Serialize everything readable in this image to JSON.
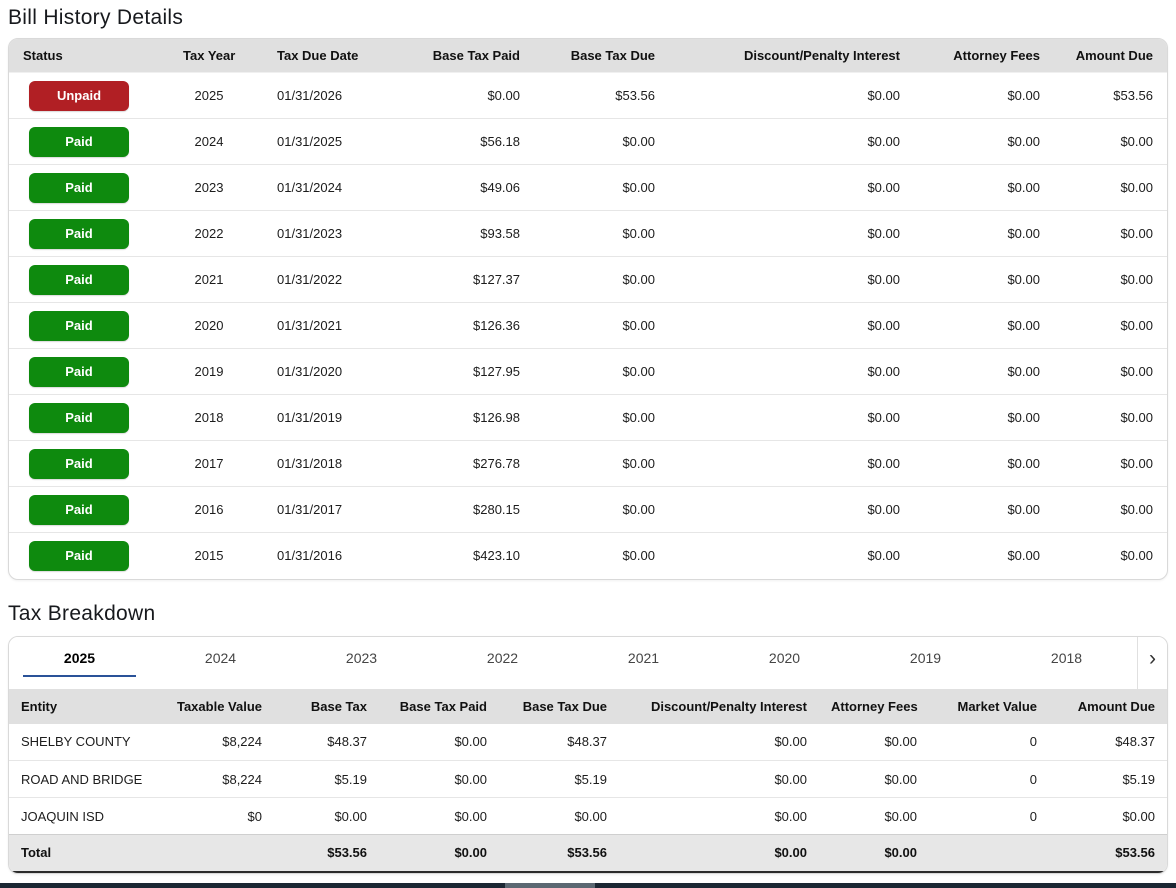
{
  "page": {
    "bill_history_title": "Bill History Details",
    "tax_breakdown_title": "Tax Breakdown"
  },
  "icons": {
    "next_tab": "›"
  },
  "colors": {
    "unpaid_badge": "#b11f24",
    "paid_badge": "#0e8a0e",
    "active_tab_underline": "#2a5298",
    "header_bg": "#e0e0e0"
  },
  "bill_history": {
    "columns": [
      "Status",
      "Tax Year",
      "Tax Due Date",
      "Base Tax Paid",
      "Base Tax Due",
      "Discount/Penalty Interest",
      "Attorney Fees",
      "Amount Due"
    ],
    "rows": [
      {
        "status": "Unpaid",
        "status_type": "unpaid",
        "tax_year": "2025",
        "tax_due_date": "01/31/2026",
        "base_tax_paid": "$0.00",
        "base_tax_due": "$53.56",
        "discount_penalty_interest": "$0.00",
        "attorney_fees": "$0.00",
        "amount_due": "$53.56"
      },
      {
        "status": "Paid",
        "status_type": "paid",
        "tax_year": "2024",
        "tax_due_date": "01/31/2025",
        "base_tax_paid": "$56.18",
        "base_tax_due": "$0.00",
        "discount_penalty_interest": "$0.00",
        "attorney_fees": "$0.00",
        "amount_due": "$0.00"
      },
      {
        "status": "Paid",
        "status_type": "paid",
        "tax_year": "2023",
        "tax_due_date": "01/31/2024",
        "base_tax_paid": "$49.06",
        "base_tax_due": "$0.00",
        "discount_penalty_interest": "$0.00",
        "attorney_fees": "$0.00",
        "amount_due": "$0.00"
      },
      {
        "status": "Paid",
        "status_type": "paid",
        "tax_year": "2022",
        "tax_due_date": "01/31/2023",
        "base_tax_paid": "$93.58",
        "base_tax_due": "$0.00",
        "discount_penalty_interest": "$0.00",
        "attorney_fees": "$0.00",
        "amount_due": "$0.00"
      },
      {
        "status": "Paid",
        "status_type": "paid",
        "tax_year": "2021",
        "tax_due_date": "01/31/2022",
        "base_tax_paid": "$127.37",
        "base_tax_due": "$0.00",
        "discount_penalty_interest": "$0.00",
        "attorney_fees": "$0.00",
        "amount_due": "$0.00"
      },
      {
        "status": "Paid",
        "status_type": "paid",
        "tax_year": "2020",
        "tax_due_date": "01/31/2021",
        "base_tax_paid": "$126.36",
        "base_tax_due": "$0.00",
        "discount_penalty_interest": "$0.00",
        "attorney_fees": "$0.00",
        "amount_due": "$0.00"
      },
      {
        "status": "Paid",
        "status_type": "paid",
        "tax_year": "2019",
        "tax_due_date": "01/31/2020",
        "base_tax_paid": "$127.95",
        "base_tax_due": "$0.00",
        "discount_penalty_interest": "$0.00",
        "attorney_fees": "$0.00",
        "amount_due": "$0.00"
      },
      {
        "status": "Paid",
        "status_type": "paid",
        "tax_year": "2018",
        "tax_due_date": "01/31/2019",
        "base_tax_paid": "$126.98",
        "base_tax_due": "$0.00",
        "discount_penalty_interest": "$0.00",
        "attorney_fees": "$0.00",
        "amount_due": "$0.00"
      },
      {
        "status": "Paid",
        "status_type": "paid",
        "tax_year": "2017",
        "tax_due_date": "01/31/2018",
        "base_tax_paid": "$276.78",
        "base_tax_due": "$0.00",
        "discount_penalty_interest": "$0.00",
        "attorney_fees": "$0.00",
        "amount_due": "$0.00"
      },
      {
        "status": "Paid",
        "status_type": "paid",
        "tax_year": "2016",
        "tax_due_date": "01/31/2017",
        "base_tax_paid": "$280.15",
        "base_tax_due": "$0.00",
        "discount_penalty_interest": "$0.00",
        "attorney_fees": "$0.00",
        "amount_due": "$0.00"
      },
      {
        "status": "Paid",
        "status_type": "paid",
        "tax_year": "2015",
        "tax_due_date": "01/31/2016",
        "base_tax_paid": "$423.10",
        "base_tax_due": "$0.00",
        "discount_penalty_interest": "$0.00",
        "attorney_fees": "$0.00",
        "amount_due": "$0.00"
      }
    ]
  },
  "tax_breakdown": {
    "tabs": [
      "2025",
      "2024",
      "2023",
      "2022",
      "2021",
      "2020",
      "2019",
      "2018"
    ],
    "active_tab": "2025",
    "columns": [
      "Entity",
      "Taxable Value",
      "Base Tax",
      "Base Tax Paid",
      "Base Tax Due",
      "Discount/Penalty Interest",
      "Attorney Fees",
      "Market Value",
      "Amount Due"
    ],
    "rows": [
      {
        "entity": "SHELBY COUNTY",
        "taxable_value": "$8,224",
        "base_tax": "$48.37",
        "base_tax_paid": "$0.00",
        "base_tax_due": "$48.37",
        "discount_penalty_interest": "$0.00",
        "attorney_fees": "$0.00",
        "market_value": "0",
        "amount_due": "$48.37"
      },
      {
        "entity": "ROAD AND BRIDGE",
        "taxable_value": "$8,224",
        "base_tax": "$5.19",
        "base_tax_paid": "$0.00",
        "base_tax_due": "$5.19",
        "discount_penalty_interest": "$0.00",
        "attorney_fees": "$0.00",
        "market_value": "0",
        "amount_due": "$5.19"
      },
      {
        "entity": "JOAQUIN ISD",
        "taxable_value": "$0",
        "base_tax": "$0.00",
        "base_tax_paid": "$0.00",
        "base_tax_due": "$0.00",
        "discount_penalty_interest": "$0.00",
        "attorney_fees": "$0.00",
        "market_value": "0",
        "amount_due": "$0.00"
      }
    ],
    "total_row": {
      "entity": "Total",
      "taxable_value": "",
      "base_tax": "$53.56",
      "base_tax_paid": "$0.00",
      "base_tax_due": "$53.56",
      "discount_penalty_interest": "$0.00",
      "attorney_fees": "$0.00",
      "market_value": "",
      "amount_due": "$53.56"
    }
  }
}
